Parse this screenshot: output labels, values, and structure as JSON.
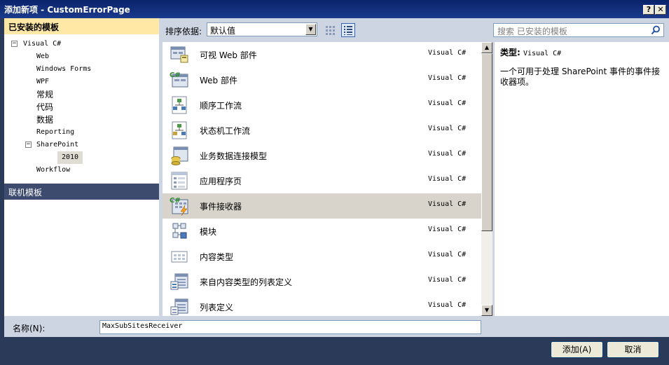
{
  "window": {
    "title": "添加新项 - CustomErrorPage",
    "help_label": "?",
    "close_label": "✕"
  },
  "sidebar": {
    "installed_header": "已安装的模板",
    "tree": {
      "root": {
        "label": "Visual C#",
        "expander": "−"
      },
      "items": [
        {
          "label": "Web"
        },
        {
          "label": "Windows Forms"
        },
        {
          "label": "WPF"
        },
        {
          "label": "常规"
        },
        {
          "label": "代码"
        },
        {
          "label": "数据"
        },
        {
          "label": "Reporting"
        },
        {
          "label": "SharePoint",
          "expander": "−"
        },
        {
          "label": "2010",
          "selected": true
        },
        {
          "label": "Workflow"
        }
      ]
    },
    "online_header": "联机模板"
  },
  "toolbar": {
    "sort_label": "排序依据:",
    "sort_value": "默认值",
    "view_modes": [
      "small-icons-view",
      "details-view"
    ],
    "search_placeholder": "搜索 已安装的模板"
  },
  "templates": [
    {
      "name": "可视 Web 部件",
      "lang": "Visual C#",
      "icon": "visual-web-part-icon"
    },
    {
      "name": "Web 部件",
      "lang": "Visual C#",
      "icon": "web-part-icon"
    },
    {
      "name": "顺序工作流",
      "lang": "Visual C#",
      "icon": "sequential-workflow-icon"
    },
    {
      "name": "状态机工作流",
      "lang": "Visual C#",
      "icon": "state-machine-workflow-icon"
    },
    {
      "name": "业务数据连接模型",
      "lang": "Visual C#",
      "icon": "bdc-model-icon"
    },
    {
      "name": "应用程序页",
      "lang": "Visual C#",
      "icon": "application-page-icon"
    },
    {
      "name": "事件接收器",
      "lang": "Visual C#",
      "icon": "event-receiver-icon",
      "selected": true
    },
    {
      "name": "模块",
      "lang": "Visual C#",
      "icon": "module-icon"
    },
    {
      "name": "内容类型",
      "lang": "Visual C#",
      "icon": "content-type-icon"
    },
    {
      "name": "来自内容类型的列表定义",
      "lang": "Visual C#",
      "icon": "list-definition-from-content-type-icon"
    },
    {
      "name": "列表定义",
      "lang": "Visual C#",
      "icon": "list-definition-icon"
    }
  ],
  "description": {
    "type_label": "类型:",
    "type_value": "Visual C#",
    "text": "一个可用于处理 SharePoint 事件的事件接收器项。"
  },
  "name_field": {
    "label": "名称(N):",
    "value": "MaxSubSitesReceiver"
  },
  "buttons": {
    "add": "添加(A)",
    "cancel": "取消"
  },
  "colors": {
    "title_bar": "#0a246a",
    "frame": "#2b3a59",
    "installed_header_bg": "#ffe8a6",
    "online_header_bg": "#3c4b6e",
    "selection_bg": "#d8d4cc"
  }
}
